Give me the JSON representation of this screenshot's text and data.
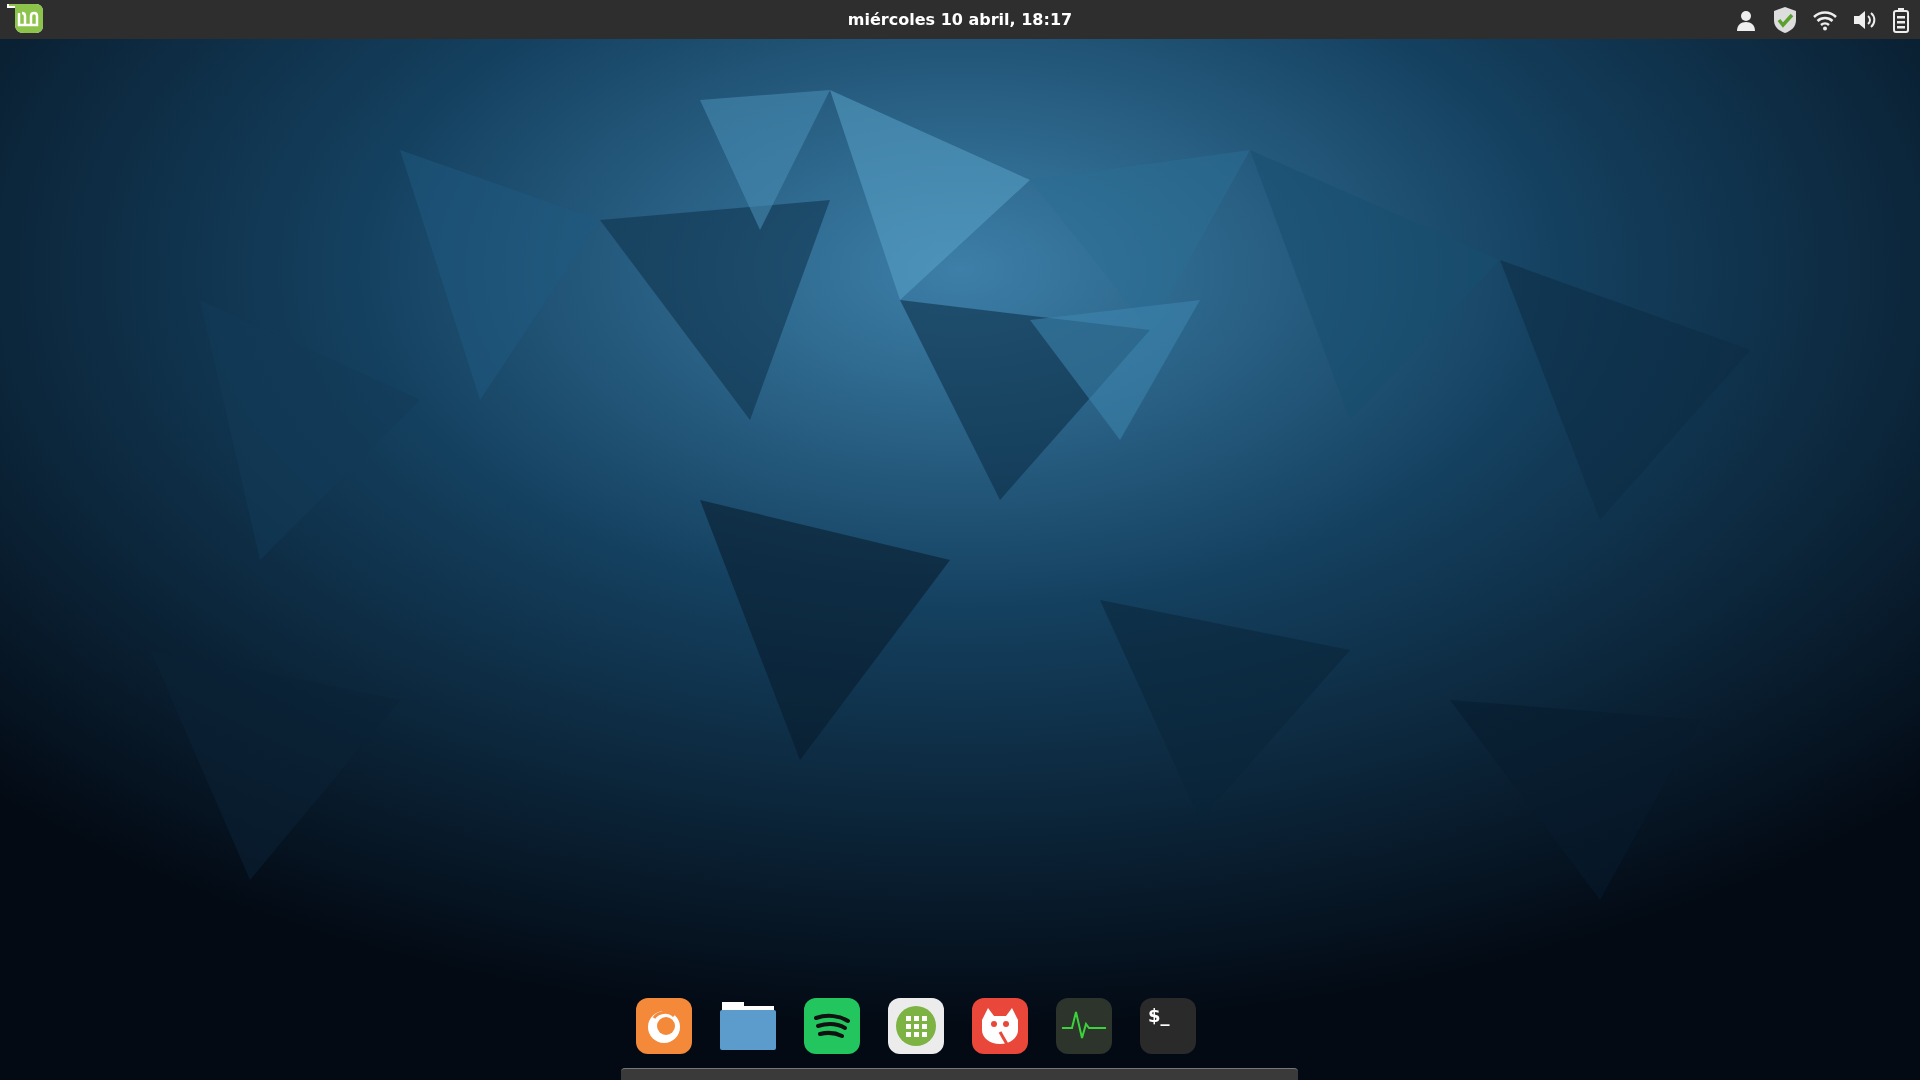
{
  "top_bar": {
    "clock": "miércoles 10 abril, 18:17"
  },
  "dock": {
    "items": [
      {
        "kind": "browser"
      },
      {
        "kind": "folder"
      },
      {
        "kind": "music"
      },
      {
        "kind": "apps"
      },
      {
        "kind": "painter"
      },
      {
        "kind": "monitor"
      },
      {
        "kind": "terminal",
        "glyph": "$_"
      }
    ]
  }
}
